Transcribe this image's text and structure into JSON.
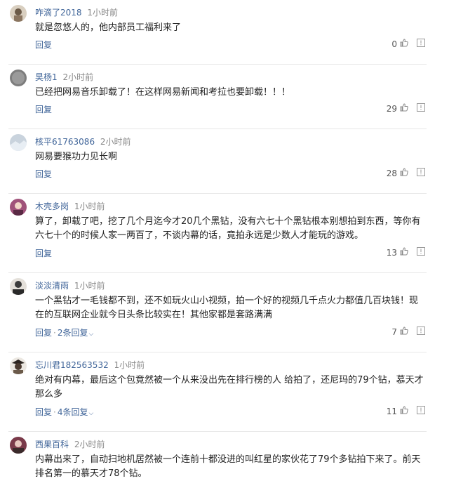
{
  "comments": [
    {
      "username": "咋滴了2018",
      "time": "1小时前",
      "text": "就是忽悠人的，他内部员工福利来了",
      "reply_label": "回复",
      "more_replies": "",
      "likes": "0",
      "avatar_color": "#d9cfc0"
    },
    {
      "username": "昊杨1",
      "time": "2小时前",
      "text": "已经把网易音乐卸载了！在这样网易新闻和考拉也要卸载！！！",
      "reply_label": "回复",
      "more_replies": "",
      "likes": "29",
      "avatar_color": "#7d7d7d"
    },
    {
      "username": "核平61763086",
      "time": "2小时前",
      "text": "网易要猴功力见长啊",
      "reply_label": "回复",
      "more_replies": "",
      "likes": "28",
      "avatar_color": "#c9d3dd"
    },
    {
      "username": "木壳多岗",
      "time": "1小时前",
      "text": "算了，卸载了吧，挖了几个月迄今才20几个黑钻，没有六七十个黑钻根本别想拍到东西，等你有六七十个的时候人家一两百了，不谈内幕的话，竟拍永远是少数人才能玩的游戏。",
      "reply_label": "回复",
      "more_replies": "",
      "likes": "13",
      "avatar_color": "#a0527a"
    },
    {
      "username": "淡淡清雨",
      "time": "1小时前",
      "text": "一个黑钻才一毛钱都不到，还不如玩火山小视频，拍一个好的视频几千点火力都值几百块钱！现在的互联网企业就今日头条比较实在！其他家都是套路满满",
      "reply_label": "回复",
      "more_replies": "2条回复",
      "likes": "7",
      "avatar_color": "#3c3c3c"
    },
    {
      "username": "忘川君182563532",
      "time": "1小时前",
      "text": "绝对有内幕，最后这个包竟然被一个从来没出先在排行榜的人 给拍了，还尼玛的79个钻，慕天才那么多",
      "reply_label": "回复",
      "more_replies": "4条回复",
      "likes": "11",
      "avatar_color": "#4a3a30"
    },
    {
      "username": "西果百科",
      "time": "2小时前",
      "text": "内幕出来了，自动扫地机居然被一个连前十都没进的叫红星的家伙花了79个多钻拍下来了。前天排名第一的慕天才78个钻。",
      "reply_label": "",
      "more_replies": "",
      "likes": "",
      "avatar_color": "#7a3a4a"
    }
  ]
}
